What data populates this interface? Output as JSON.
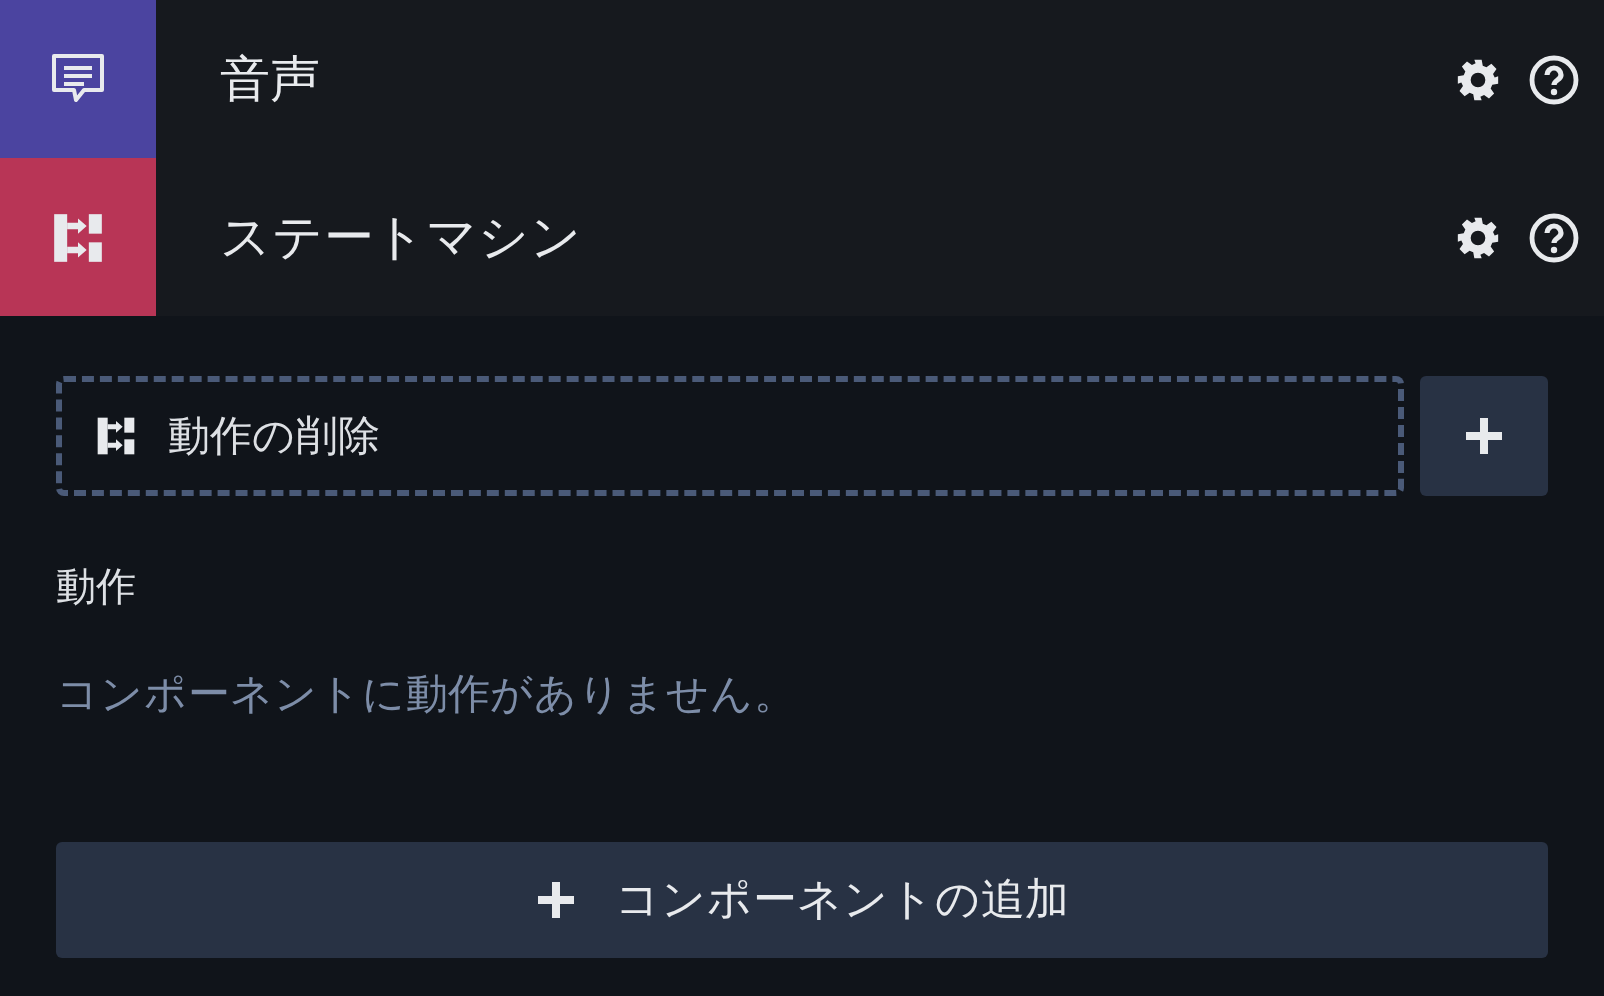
{
  "components": [
    {
      "name": "音声",
      "kind": "audio",
      "color": "#4b44a0"
    },
    {
      "name": "ステートマシン",
      "kind": "state_machine",
      "color": "#b83556"
    }
  ],
  "action_slot": {
    "label": "動作の削除"
  },
  "actions": {
    "heading": "動作",
    "empty_message": "コンポーネントに動作がありません。"
  },
  "add_component_button": {
    "label": "コンポーネントの追加"
  }
}
